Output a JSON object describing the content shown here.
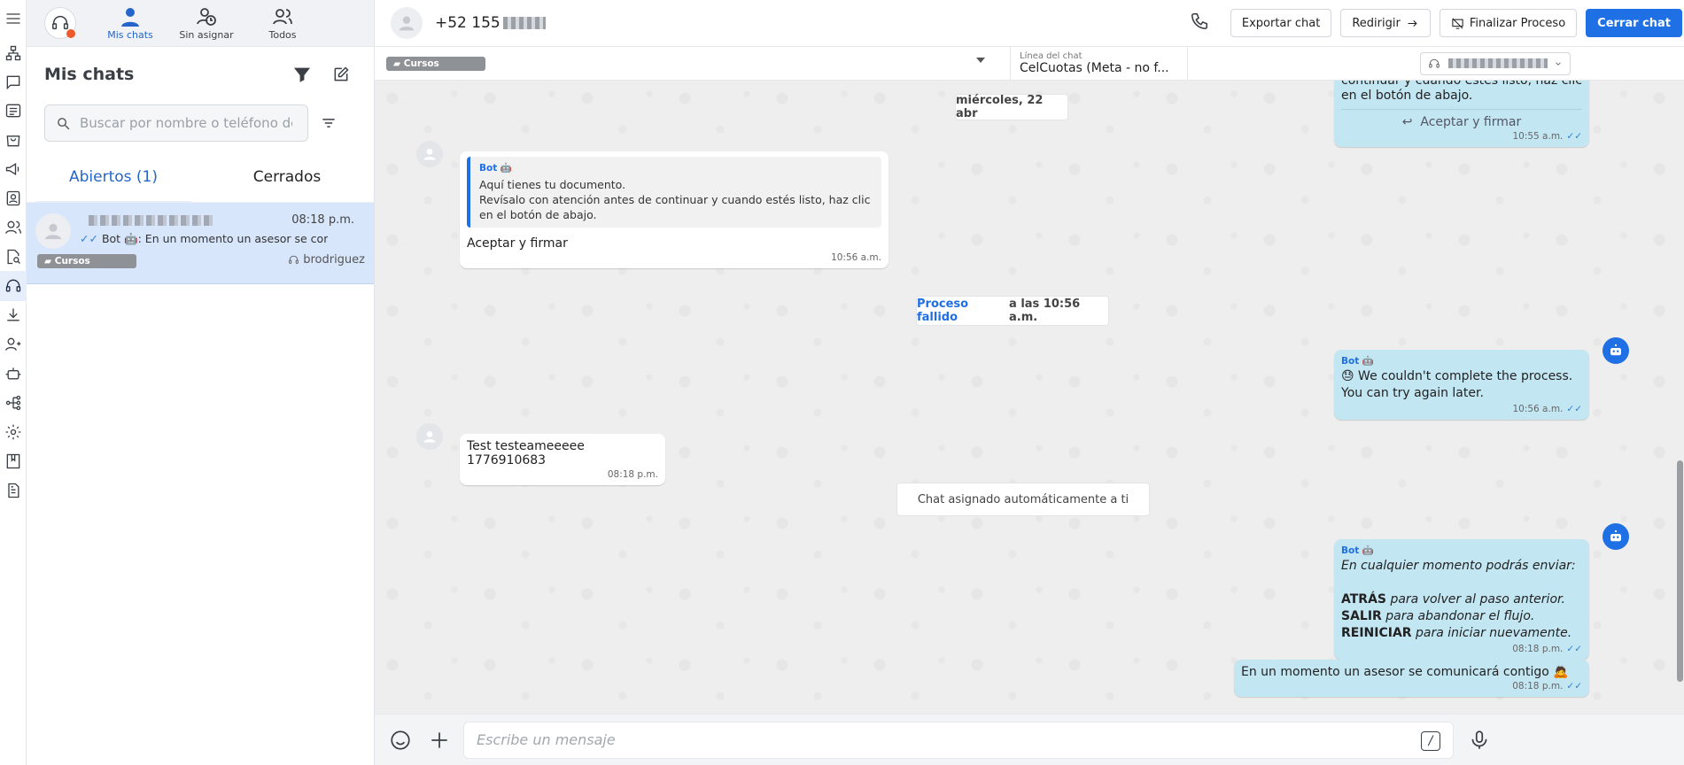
{
  "rail": {
    "items": [
      {
        "name": "menu-icon"
      },
      {
        "name": "org-chart-icon"
      },
      {
        "name": "chat-bubble-icon"
      },
      {
        "name": "list-icon"
      },
      {
        "name": "shopping-bag-icon"
      },
      {
        "name": "megaphone-icon"
      },
      {
        "name": "contacts-icon"
      },
      {
        "name": "users-icon"
      },
      {
        "name": "doc-search-icon"
      },
      {
        "name": "headset-icon"
      },
      {
        "name": "download-icon"
      },
      {
        "name": "user-group-icon"
      },
      {
        "name": "robot-icon"
      },
      {
        "name": "flow-icon"
      },
      {
        "name": "gear-icon"
      },
      {
        "name": "book-icon"
      },
      {
        "name": "report-icon"
      }
    ]
  },
  "topnav": {
    "tabs": [
      {
        "label": "Mis chats"
      },
      {
        "label": "Sin asignar"
      },
      {
        "label": "Todos"
      }
    ]
  },
  "list": {
    "title": "Mis chats",
    "search_placeholder": "Buscar por nombre o teléfono de",
    "tabs": [
      {
        "label": "Abiertos (1)"
      },
      {
        "label": "Cerrados"
      }
    ],
    "chats": [
      {
        "time": "08:18 p.m.",
        "preview": "Bot 🤖: En un momento un asesor se cor",
        "tag": "Cursos",
        "agent": "brodriguez"
      }
    ]
  },
  "header": {
    "phone": "+52 155",
    "buttons": {
      "export": "Exportar chat",
      "redirect": "Redirigir",
      "finish": "Finalizar Proceso",
      "close": "Cerrar chat"
    },
    "tag": "Cursos",
    "line_label": "Línea del chat",
    "line_value": "CelCuotas (Meta - no f..."
  },
  "messages": {
    "top_partial": {
      "text": "continuar y cuando estés listo, haz clic en el botón de abajo.",
      "button": "Aceptar y firmar",
      "time": "10:55 a.m."
    },
    "date_divider": "miércoles, 22 abr",
    "doc_message": {
      "sender": "Bot 🤖",
      "line1": "Aquí tienes tu documento.",
      "line2": "Revísalo con atención antes de continuar y cuando estés listo, haz clic en el botón de abajo.",
      "reply": "Aceptar y firmar",
      "time": "10:56 a.m."
    },
    "process_failed": {
      "highlight": "Proceso fallido",
      "rest": " a las 10:56 a.m."
    },
    "bot_fail": {
      "sender": "Bot 🤖",
      "line1": "😓 We couldn't complete the process.",
      "line2": "You can try again later.",
      "time": "10:56 a.m."
    },
    "test_message": {
      "text": "Test testeameeeee 1776910683",
      "time": "08:18 p.m."
    },
    "assigned": "Chat asignado automáticamente a ti",
    "bot_options": {
      "sender": "Bot 🤖",
      "intro": "En cualquier momento podrás enviar:",
      "opt1_key": "ATRÁS",
      "opt1_text": " para volver al paso anterior.",
      "opt2_key": "SALIR",
      "opt2_text": " para abandonar el flujo.",
      "opt3_key": "REINICIAR",
      "opt3_text": " para iniciar nuevamente.",
      "time": "08:18 p.m."
    },
    "bot_wait": {
      "text": "En un momento un asesor se comunicará contigo 🙇",
      "time": "08:18 p.m."
    }
  },
  "composer": {
    "placeholder": "Escribe un mensaje",
    "slash": "/"
  }
}
